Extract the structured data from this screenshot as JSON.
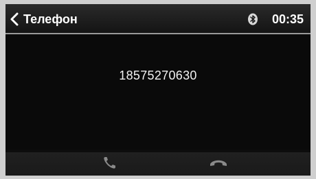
{
  "header": {
    "back_label": "Телефон",
    "bluetooth_icon": "bluetooth-icon",
    "time": "00:35"
  },
  "dialer": {
    "number": "18575270630"
  },
  "footer": {
    "call_icon": "phone-call-icon",
    "hangup_icon": "phone-hangup-icon"
  },
  "colors": {
    "background": "#0a0a0a",
    "header": "#1f1f1f",
    "divider": "#9a9a9a",
    "icon_gray": "#8a8a8a",
    "text": "#ffffff"
  }
}
